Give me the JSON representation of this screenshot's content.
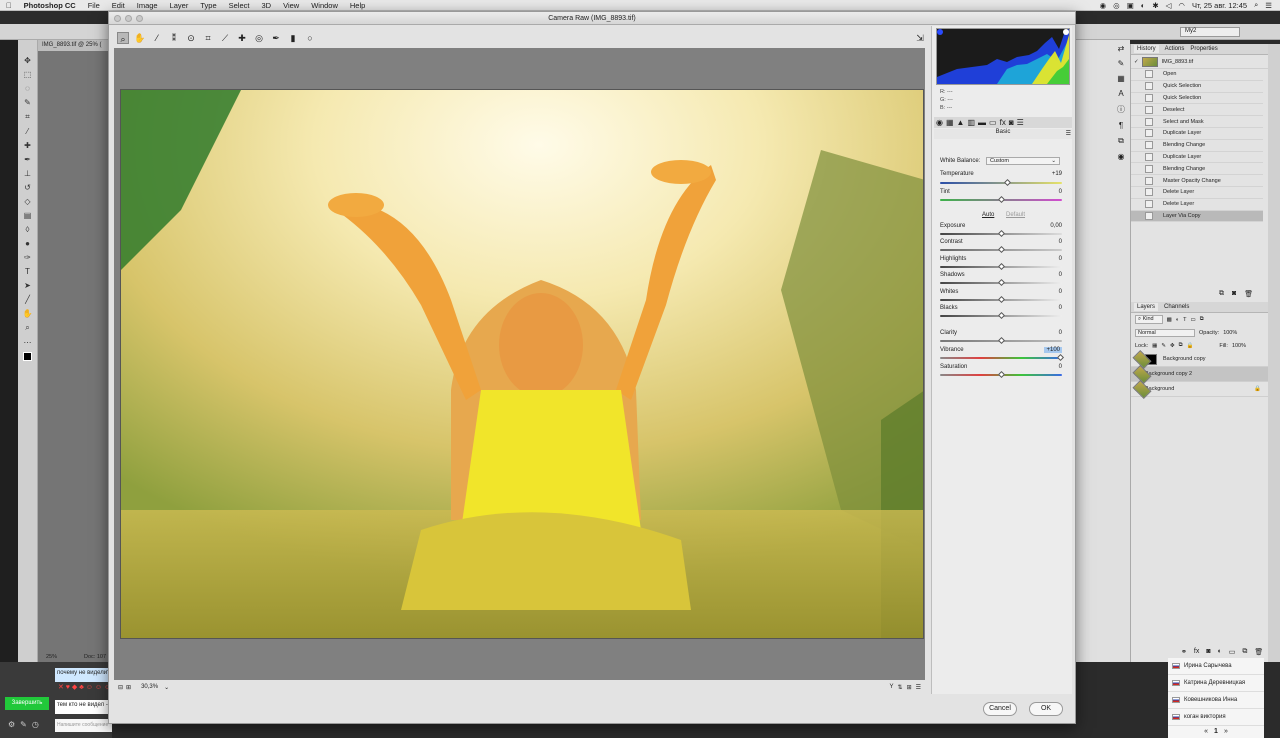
{
  "menubar": {
    "app": "Photoshop CC",
    "items": [
      "File",
      "Edit",
      "Image",
      "Layer",
      "Type",
      "Select",
      "3D",
      "View",
      "Window",
      "Help"
    ],
    "clock": "Чт, 25 авг.  12:45"
  },
  "ps": {
    "doc_tab": "IMG_8893.tif @ 25% (",
    "doc_zoom": "25%",
    "doc_info": "Doc: 107",
    "workspace": "My2",
    "history_tabs": [
      "History",
      "Actions",
      "Properties"
    ],
    "history_snapshot": "IMG_8893.tif",
    "history_items": [
      "Open",
      "Quick Selection",
      "Quick Selection",
      "Deselect",
      "Select and Mask",
      "Duplicate Layer",
      "Blending Change",
      "Duplicate Layer",
      "Blending Change",
      "Master Opacity Change",
      "Delete Layer",
      "Delete Layer",
      "Layer Via Copy"
    ],
    "layers_tabs": [
      "Layers",
      "Channels"
    ],
    "layers_kind": "Kind",
    "blend_mode": "Normal",
    "opacity_label": "Opacity:",
    "opacity": "100%",
    "lock_label": "Lock:",
    "fill_label": "Fill:",
    "fill": "100%",
    "layers": [
      "Background copy",
      "Background copy 2",
      "Background"
    ]
  },
  "chat": {
    "note1": "почему не видели?",
    "note2": "тем кто не видел -",
    "button": "Завершить",
    "input_placeholder": "Напишите сообщение",
    "users": [
      "Ирина Сарычева",
      "Катрина Деревницкая",
      "Ковешникова Инна",
      "коган виктория"
    ],
    "page": "1"
  },
  "camera_raw": {
    "title": "Camera Raw (IMG_8893.tif)",
    "rgb": {
      "r_label": "R:",
      "g_label": "G:",
      "b_label": "B:",
      "r": "---",
      "g": "---",
      "b": "---"
    },
    "panel_title": "Basic",
    "wb_label": "White Balance:",
    "wb_value": "Custom",
    "auto": "Auto",
    "default": "Default",
    "zoom": "30,3%",
    "cancel": "Cancel",
    "ok": "OK",
    "sliders": {
      "temperature": {
        "label": "Temperature",
        "value": "+19"
      },
      "tint": {
        "label": "Tint",
        "value": "0"
      },
      "exposure": {
        "label": "Exposure",
        "value": "0,00"
      },
      "contrast": {
        "label": "Contrast",
        "value": "0"
      },
      "highlights": {
        "label": "Highlights",
        "value": "0"
      },
      "shadows": {
        "label": "Shadows",
        "value": "0"
      },
      "whites": {
        "label": "Whites",
        "value": "0"
      },
      "blacks": {
        "label": "Blacks",
        "value": "0"
      },
      "clarity": {
        "label": "Clarity",
        "value": "0"
      },
      "vibrance": {
        "label": "Vibrance",
        "value": "+100"
      },
      "saturation": {
        "label": "Saturation",
        "value": "0"
      }
    }
  }
}
